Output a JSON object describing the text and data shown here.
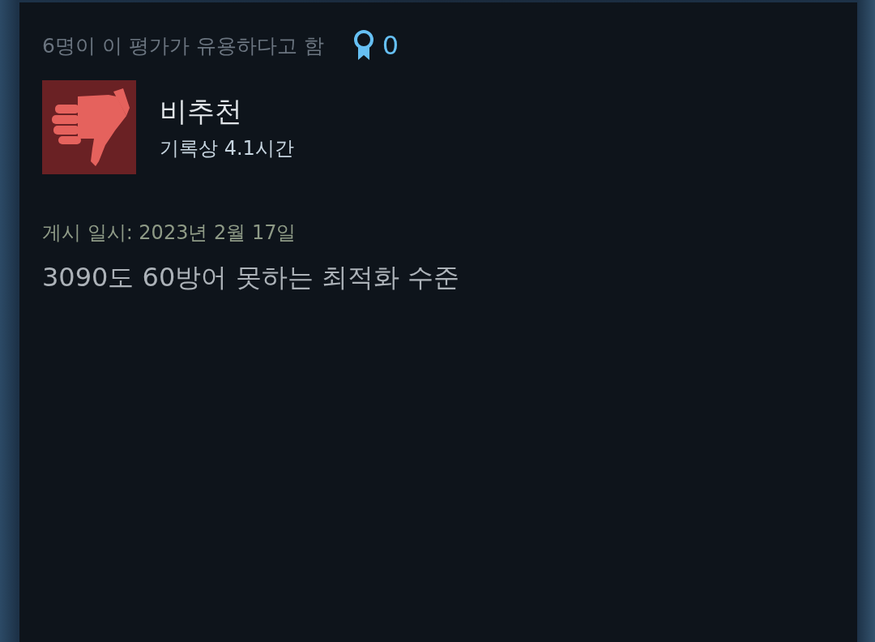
{
  "helpful": "6명이 이 평가가 유용하다고 함",
  "award_count": "0",
  "rating": {
    "kind": "negative",
    "label": "비추천"
  },
  "playtime": "기록상 4.1시간",
  "posted": "게시 일시: 2023년 2월 17일",
  "review_text": "3090도 60방어 못하는 최적화 수준"
}
